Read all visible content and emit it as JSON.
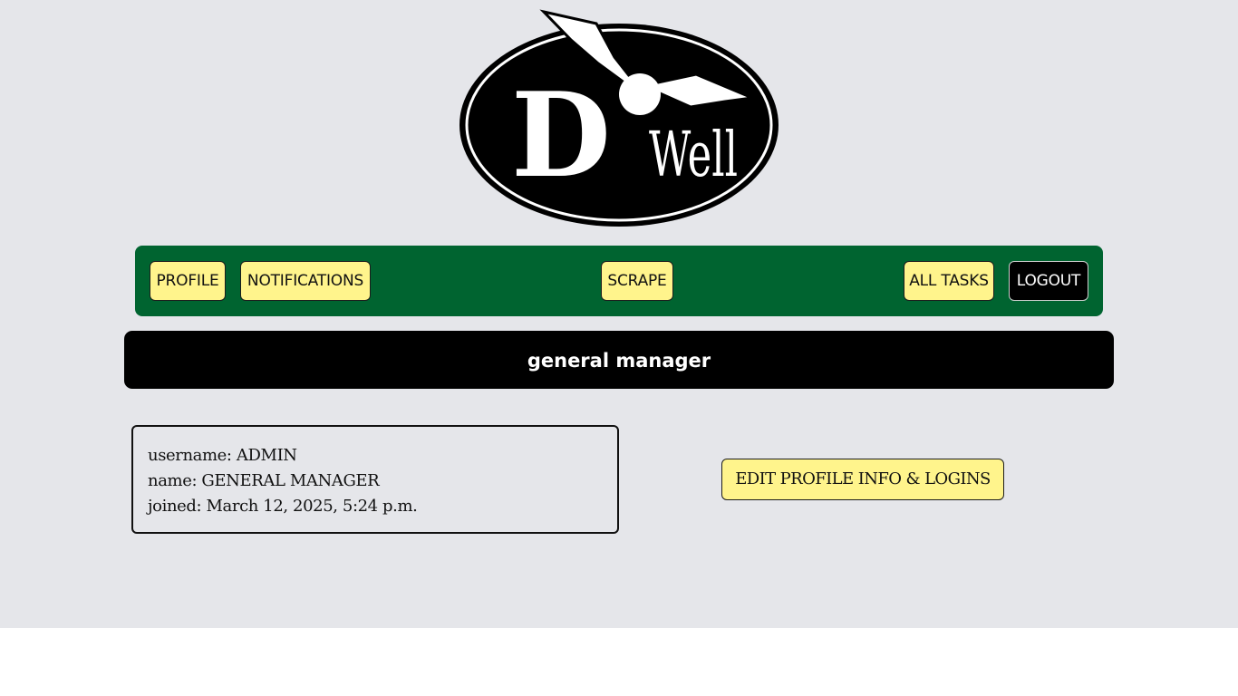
{
  "logo": {
    "letter": "D",
    "word": "Well"
  },
  "nav": {
    "profile": "PROFILE",
    "notifications": "NOTIFICATIONS",
    "scrape": "SCRAPE",
    "all_tasks": "ALL TASKS",
    "logout": "LOGOUT"
  },
  "page_title": "general manager",
  "profile_info": {
    "username": "username: ADMIN",
    "name": "name: GENERAL MANAGER",
    "joined": "joined: March 12, 2025, 5:24 p.m."
  },
  "edit_button": "EDIT PROFILE INFO & LOGINS",
  "colors": {
    "background": "#e5e6ea",
    "navbar": "#006430",
    "button": "#fff48c",
    "logout_button": "#000000",
    "title_bar": "#000000"
  }
}
